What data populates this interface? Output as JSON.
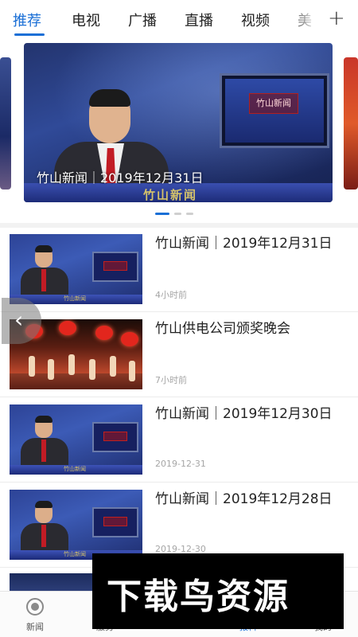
{
  "tabs": [
    {
      "label": "推荐",
      "active": true
    },
    {
      "label": "电视",
      "active": false
    },
    {
      "label": "广播",
      "active": false
    },
    {
      "label": "直播",
      "active": false
    },
    {
      "label": "视频",
      "active": false
    },
    {
      "label": "美",
      "active": false
    }
  ],
  "tab_more_icon": "plus-icon",
  "accent_color": "#1a6fd6",
  "banner": {
    "caption": "竹山新闻｜2019年12月31日",
    "desk_text": "竹山新闻",
    "monitor_text": "竹山新闻",
    "carousel_pages": 3,
    "carousel_current": 1
  },
  "news": [
    {
      "title": "竹山新闻｜2019年12月31日",
      "time": "4小时前",
      "thumb": "studio",
      "thumb_text": "竹山新闻"
    },
    {
      "title": "竹山供电公司颁奖晚会",
      "time": "7小时前",
      "thumb": "stage"
    },
    {
      "title": "竹山新闻｜2019年12月30日",
      "time": "2019-12-31",
      "thumb": "studio",
      "thumb_text": "竹山新闻"
    },
    {
      "title": "竹山新闻｜2019年12月28日",
      "time": "2019-12-30",
      "thumb": "studio",
      "thumb_text": "竹山新闻"
    }
  ],
  "back_icon": "chevron-left-icon",
  "bottom_nav": [
    {
      "label": "新闻",
      "icon": "globe-icon",
      "active": false
    },
    {
      "label": "服务",
      "icon": "grid-icon",
      "active": false
    },
    {
      "label": "报料",
      "icon": "camera-icon",
      "active": true
    },
    {
      "label": "我的",
      "icon": "user-icon",
      "active": false
    }
  ],
  "watermark": "下载鸟资源"
}
